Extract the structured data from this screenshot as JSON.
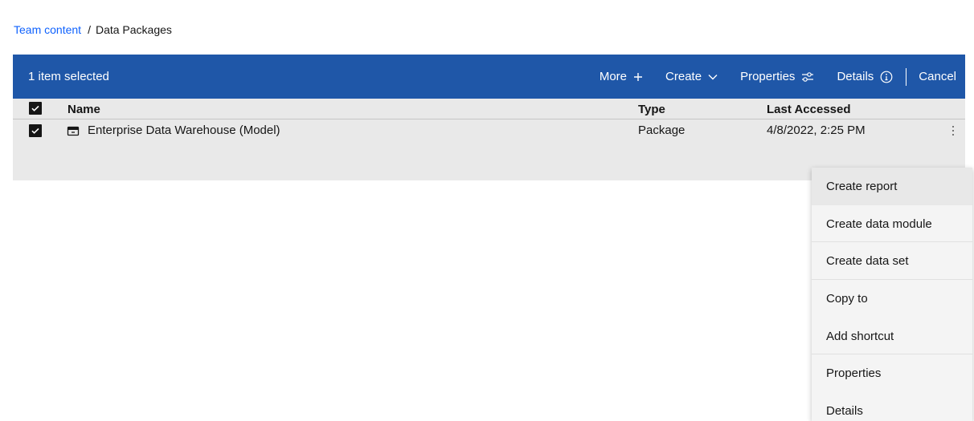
{
  "breadcrumb": {
    "parent": "Team content",
    "separator": "/",
    "current": "Data Packages"
  },
  "action_bar": {
    "selection_text": "1 item selected",
    "more_label": "More",
    "create_label": "Create",
    "properties_label": "Properties",
    "details_label": "Details",
    "cancel_label": "Cancel",
    "background_color": "#1f57a8"
  },
  "table": {
    "columns": [
      "Name",
      "Type",
      "Last Accessed"
    ],
    "rows": [
      {
        "name": "Enterprise Data Warehouse (Model)",
        "type": "Package",
        "last_accessed": "4/8/2022, 2:25 PM",
        "selected": true,
        "icon": "package-icon"
      }
    ],
    "all_selected": true
  },
  "context_menu": {
    "items": [
      "Create report",
      "Create data module",
      "Create data set",
      "Copy to",
      "Add shortcut",
      "Properties",
      "Details"
    ],
    "highlighted": "Create report"
  },
  "colors": {
    "link": "#0f62fe",
    "panel_bg": "#e9e9e9",
    "menu_bg": "#f4f4f4"
  }
}
